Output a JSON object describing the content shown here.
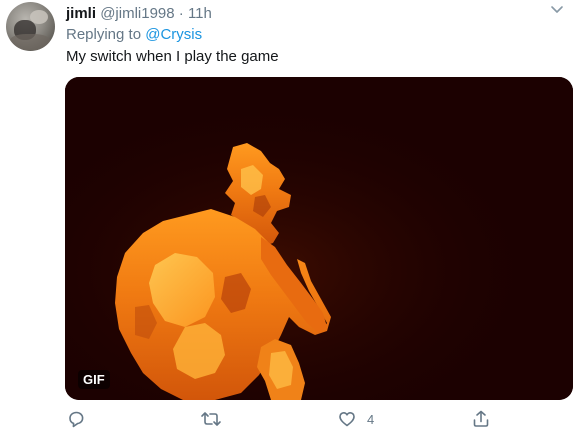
{
  "tweet": {
    "display_name": "jimli",
    "handle": "@jimli1998",
    "separator": "·",
    "time": "11h",
    "reply_prefix": "Replying to",
    "reply_to": "@Crysis",
    "text": "My switch when I play the game"
  },
  "media": {
    "badge": "GIF",
    "description_icon": "burning-figure"
  },
  "actions": {
    "reply_icon": "reply-icon",
    "retweet_icon": "retweet-icon",
    "like_icon": "heart-icon",
    "like_count": "4",
    "share_icon": "share-icon"
  },
  "colors": {
    "link": "#1b95e0",
    "secondary_text": "#657786",
    "primary_text": "#14171a",
    "media_background": "#1c0101"
  }
}
